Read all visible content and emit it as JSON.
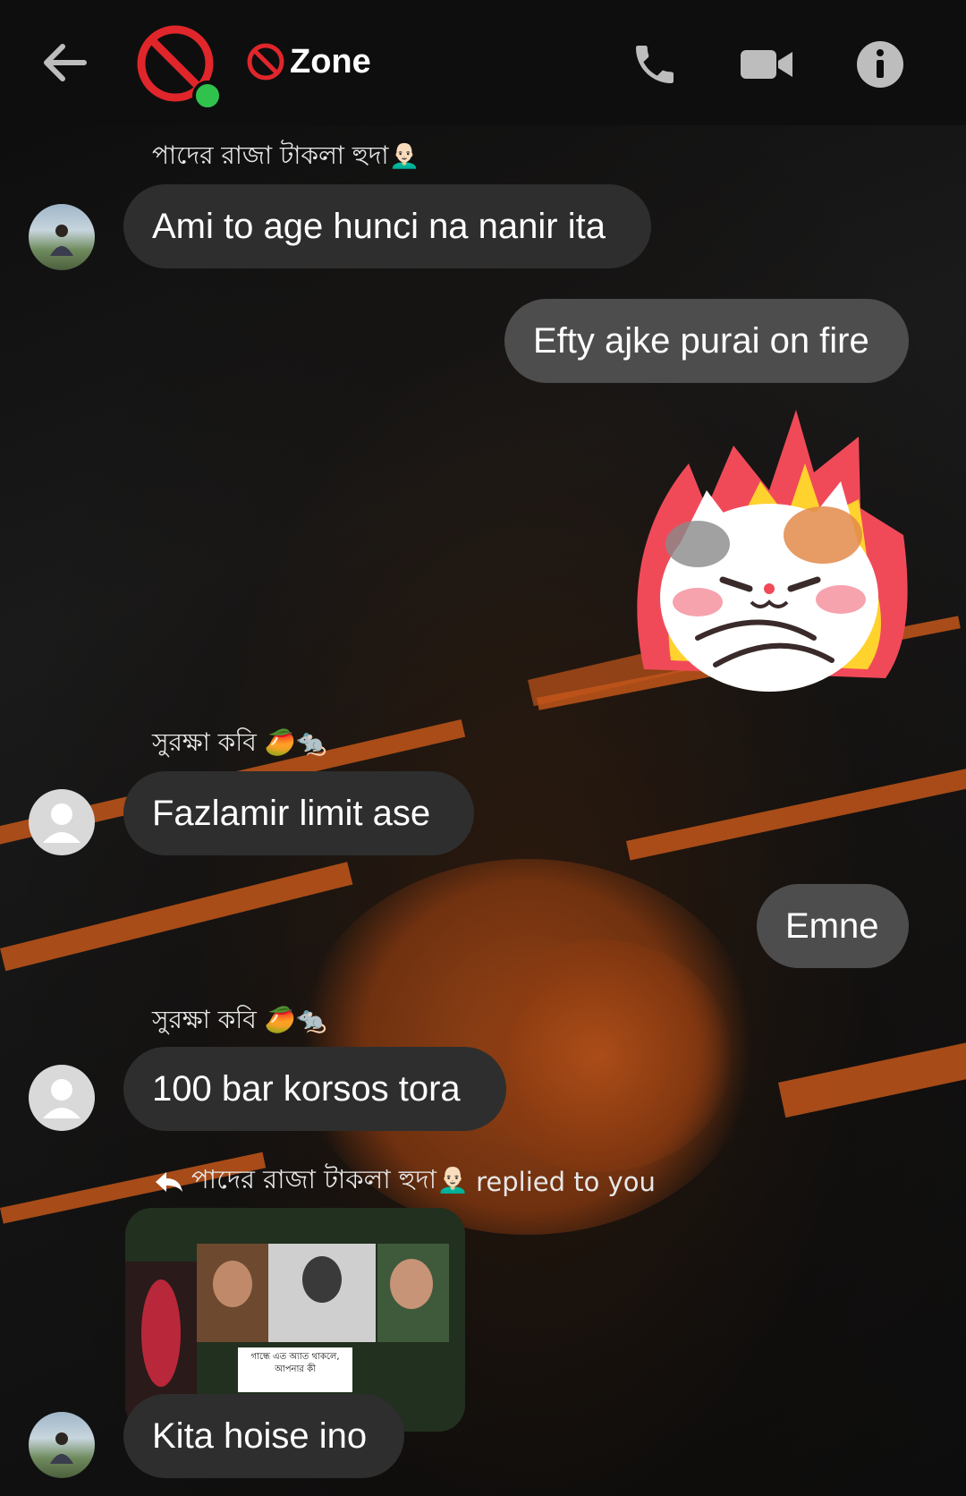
{
  "header": {
    "title": "Zone",
    "icons": [
      "back-arrow-icon",
      "prohibited-icon",
      "phone-icon",
      "video-camera-icon",
      "info-icon"
    ]
  },
  "messages": [
    {
      "sender": "পাদের রাজা টাকলা হুদা👨🏻‍🦲",
      "text": "Ami to age hunci na nanir ita",
      "direction": "incoming"
    },
    {
      "text": "Efty ajke purai on fire",
      "direction": "outgoing"
    },
    {
      "sticker": "angry-cat-on-fire",
      "direction": "outgoing"
    },
    {
      "sender": "সুরক্ষা কবি 🥭🐀",
      "text": "Fazlamir limit ase",
      "direction": "incoming"
    },
    {
      "text": "Emne",
      "direction": "outgoing"
    },
    {
      "sender": "সুরক্ষা কবি 🥭🐀",
      "text": "100 bar korsos tora",
      "direction": "incoming"
    },
    {
      "reply_sender": "পাদের রাজা টাকলা হুদা👨🏻‍🦲",
      "reply_suffix": "replied to you",
      "reply_image_caption": "গান্ধে এত অ্যাত থাকলে, আপনার কী",
      "text": "Kita hoise ino",
      "direction": "incoming"
    }
  ],
  "colors": {
    "incoming_bubble": "#2e2e2e",
    "outgoing_bubble": "#4d4d4d",
    "presence": "#31c24d",
    "accent": "#e0262b"
  }
}
